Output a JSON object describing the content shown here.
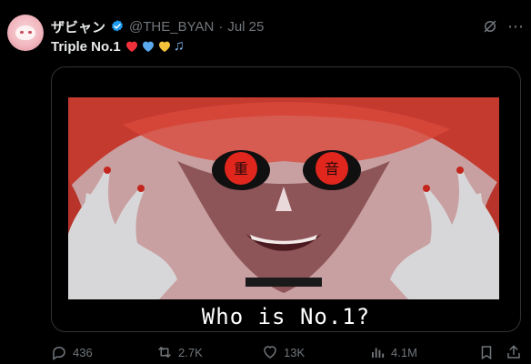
{
  "tweet": {
    "author_name": "ザビャン",
    "handle": "@THE_BYAN",
    "separator": "·",
    "date": "Jul 25",
    "text": "Triple No.1",
    "emojis": [
      "red-heart",
      "blue-heart",
      "yellow-heart",
      "music-notes"
    ]
  },
  "media": {
    "caption": "Who is No.1?"
  },
  "actions": {
    "replies": "436",
    "retweets": "2.7K",
    "likes": "13K",
    "views": "4.1M"
  },
  "colors": {
    "background": "#000000",
    "text": "#e7e9ea",
    "muted": "#71767b",
    "verified": "#1d9bf0",
    "accent_red": "#d83a34"
  },
  "icons": [
    "verified-badge-icon",
    "grok-icon",
    "more-icon",
    "reply-icon",
    "retweet-icon",
    "like-icon",
    "views-icon",
    "bookmark-icon",
    "share-icon"
  ]
}
